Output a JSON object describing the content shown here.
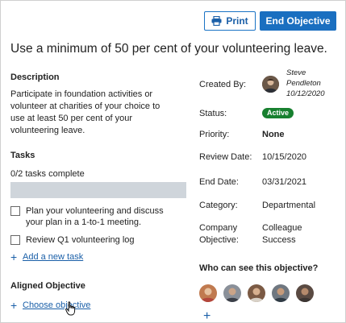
{
  "header": {
    "print_label": "Print",
    "end_label": "End Objective"
  },
  "objective": {
    "title": "Use a minimum of 50 per cent of your volunteering leave.",
    "description_heading": "Description",
    "description_lines": [
      "Participate in foundation activities or",
      "volunteer at charities of your choice to",
      "use at least 50 per cent of your",
      "volunteering leave."
    ]
  },
  "tasks": {
    "heading": "Tasks",
    "progress_text": "0/2 tasks complete",
    "progress_fraction": 0,
    "items": [
      {
        "label_lines": [
          "Plan your volunteering and discuss",
          "your plan in a 1-to-1 meeting."
        ],
        "checked": false
      },
      {
        "label_lines": [
          "Review Q1 volunteering log"
        ],
        "checked": false
      }
    ],
    "add_label": "Add a new task"
  },
  "aligned": {
    "heading": "Aligned Objective",
    "choose_label": "Choose objective"
  },
  "details": {
    "created_by_label": "Created By:",
    "creator_lines": [
      "Steve",
      "Pendleton",
      "10/12/2020"
    ],
    "status_label": "Status:",
    "status_value": "Active",
    "priority_label": "Priority:",
    "priority_value": "None",
    "review_date_label": "Review Date:",
    "review_date_value": "10/15/2020",
    "end_date_label": "End Date:",
    "end_date_value": "03/31/2021",
    "category_label": "Category:",
    "category_value": "Departmental",
    "company_objective_label_lines": [
      "Company",
      "Objective:"
    ],
    "company_objective_value_lines": [
      "Colleague",
      "Success"
    ]
  },
  "viewers": {
    "heading": "Who can see this objective?",
    "avatars": [
      {
        "name": "viewer-avatar-1",
        "color": "#c07a4f"
      },
      {
        "name": "viewer-avatar-2",
        "color": "#3b3f48"
      },
      {
        "name": "viewer-avatar-3",
        "color": "#7b5a44"
      },
      {
        "name": "viewer-avatar-4",
        "color": "#2f3a44"
      },
      {
        "name": "viewer-avatar-5",
        "color": "#5a4a42"
      }
    ]
  },
  "colors": {
    "primary": "#1a6fc0",
    "link": "#1a5fa8",
    "active_badge": "#17802f",
    "progress_track": "#cfd5db"
  }
}
